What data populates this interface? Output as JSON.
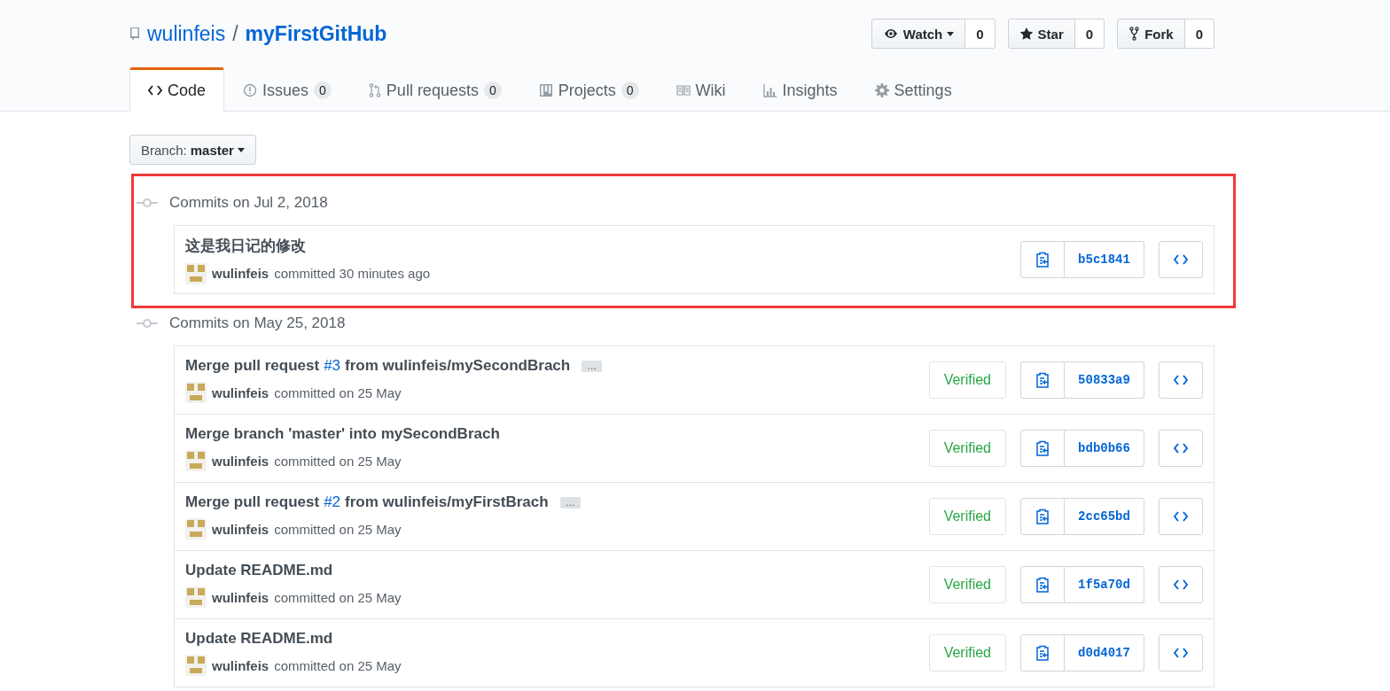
{
  "repo": {
    "owner": "wulinfeis",
    "separator": "/",
    "name": "myFirstGitHub"
  },
  "actions": [
    {
      "kind": "watch",
      "label": "Watch",
      "count": "0"
    },
    {
      "kind": "star",
      "label": "Star",
      "count": "0"
    },
    {
      "kind": "fork",
      "label": "Fork",
      "count": "0"
    }
  ],
  "tabs": [
    {
      "label": "Code",
      "selected": true
    },
    {
      "label": "Issues",
      "counter": "0",
      "selected": false
    },
    {
      "label": "Pull requests",
      "counter": "0",
      "selected": false
    },
    {
      "label": "Projects",
      "counter": "0",
      "selected": false
    },
    {
      "label": "Wiki",
      "selected": false
    },
    {
      "label": "Insights",
      "selected": false
    },
    {
      "label": "Settings",
      "selected": false
    }
  ],
  "branch": {
    "label": "Branch:",
    "value": "master"
  },
  "groups": [
    {
      "heading": "Commits on Jul 2, 2018",
      "highlighted": true,
      "commits": [
        {
          "title": "这是我日记的修改",
          "author": "wulinfeis",
          "meta": "committed 30 minutes ago",
          "sha": "b5c1841"
        }
      ]
    },
    {
      "heading": "Commits on May 25, 2018",
      "highlighted": false,
      "commits": [
        {
          "title": "Merge pull request",
          "link": "#3",
          "title_rest": "from wulinfeis/mySecondBrach",
          "expander": "…",
          "author": "wulinfeis",
          "meta": "committed on 25 May",
          "verified": "Verified",
          "sha": "50833a9"
        },
        {
          "title": "Merge branch 'master' into mySecondBrach",
          "author": "wulinfeis",
          "meta": "committed on 25 May",
          "verified": "Verified",
          "sha": "bdb0b66"
        },
        {
          "title": "Merge pull request",
          "link": "#2",
          "title_rest": "from wulinfeis/myFirstBrach",
          "expander": "…",
          "author": "wulinfeis",
          "meta": "committed on 25 May",
          "verified": "Verified",
          "sha": "2cc65bd"
        },
        {
          "title": "Update README.md",
          "author": "wulinfeis",
          "meta": "committed on 25 May",
          "verified": "Verified",
          "sha": "1f5a70d"
        },
        {
          "title": "Update README.md",
          "author": "wulinfeis",
          "meta": "committed on 25 May",
          "verified": "Verified",
          "sha": "d0d4017"
        }
      ]
    }
  ]
}
